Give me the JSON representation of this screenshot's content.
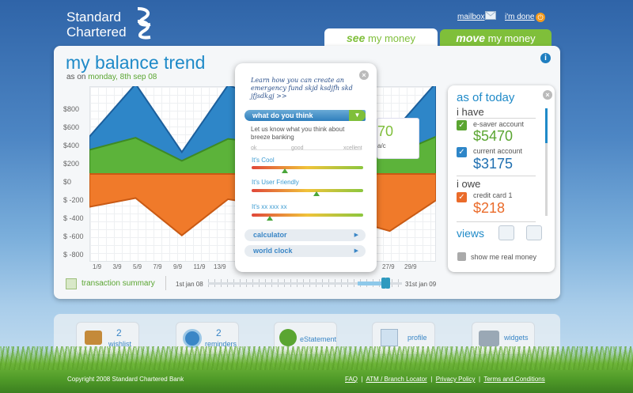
{
  "brand": {
    "line1": "Standard",
    "line2": "Chartered"
  },
  "topnav": {
    "mailbox": "mailbox",
    "done": "i'm done"
  },
  "tabs": [
    {
      "em": "see",
      "label": "my money"
    },
    {
      "em": "move",
      "label": "my money"
    }
  ],
  "main": {
    "title": "my balance trend",
    "asof_prefix": "as on",
    "asof_date": "monday, 8th sep 08",
    "info_icon": "i"
  },
  "chart_data": {
    "type": "area",
    "y_ticks": [
      "$800",
      "$600",
      "$400",
      "$200",
      "$0",
      "$ -200",
      "$ -400",
      "$ -600",
      "$ -800"
    ],
    "x_ticks_left": [
      "1/9",
      "3/9",
      "5/9",
      "7/9",
      "9/9",
      "11/9",
      "13/9"
    ],
    "x_ticks_right": [
      "27/9",
      "29/9"
    ],
    "ylim": [
      -800,
      800
    ],
    "x": [
      1,
      5,
      9,
      13,
      23,
      27,
      31
    ],
    "series": [
      {
        "values": [
          340,
          820,
          200,
          810,
          420,
          350,
          830
        ]
      },
      {
        "values": [
          220,
          330,
          120,
          320,
          200,
          160,
          340
        ]
      },
      {
        "values": [
          -300,
          -220,
          -560,
          -230,
          -400,
          -520,
          -240
        ]
      }
    ]
  },
  "peek": {
    "value": "70",
    "unit": "a/c"
  },
  "transaction": {
    "label": "transaction summary",
    "range_start": "1st jan 08",
    "range_end": "31st jan 09",
    "selection": [
      0.77,
      0.94
    ]
  },
  "popup": {
    "note": "Learn how you can create  an emergency fund skjd ksdjfh skd jfjsdkgj",
    "note_more": ">>",
    "header": "what do you think",
    "intro": "Let us know what you think about breeze banking",
    "scale": [
      "ok",
      "good",
      "xcellent"
    ],
    "questions": [
      {
        "label": "It's Cool",
        "level": 0.3
      },
      {
        "label": "It's User Friendly",
        "level": 0.58
      },
      {
        "label": "It's xx xxx xx",
        "level": 0.16
      }
    ],
    "links": [
      "calculator",
      "world clock"
    ],
    "close": "×"
  },
  "side": {
    "title": "as of today",
    "have_heading": "i have",
    "owe_heading": "i owe",
    "accounts_have": [
      {
        "name": "e-saver account",
        "value": "$5470"
      },
      {
        "name": "current account",
        "value": "$3175"
      }
    ],
    "accounts_owe": [
      {
        "name": "credit card 1",
        "value": "$218"
      }
    ],
    "views_label": "views",
    "real_money_label": "show me real money",
    "close": "×"
  },
  "dock": [
    {
      "count": "2",
      "label": "wishlist"
    },
    {
      "count": "2",
      "label": "reminders"
    },
    {
      "count": "",
      "label": "eStatement"
    },
    {
      "count": "",
      "label": "profile"
    },
    {
      "count": "",
      "label": "widgets"
    }
  ],
  "footer": {
    "copyright": "Copyright 2008 Standard Chartered Bank",
    "links": [
      "FAQ",
      "ATM / Branch Locator",
      "Privacy Policy",
      "Terms and Conditions"
    ]
  },
  "colors": {
    "brand_blue": "#1f8ac8",
    "brand_green": "#7fbf3a",
    "series_blue": "#2e86c8",
    "series_green": "#5cb33a",
    "series_orange": "#f07a2a"
  }
}
